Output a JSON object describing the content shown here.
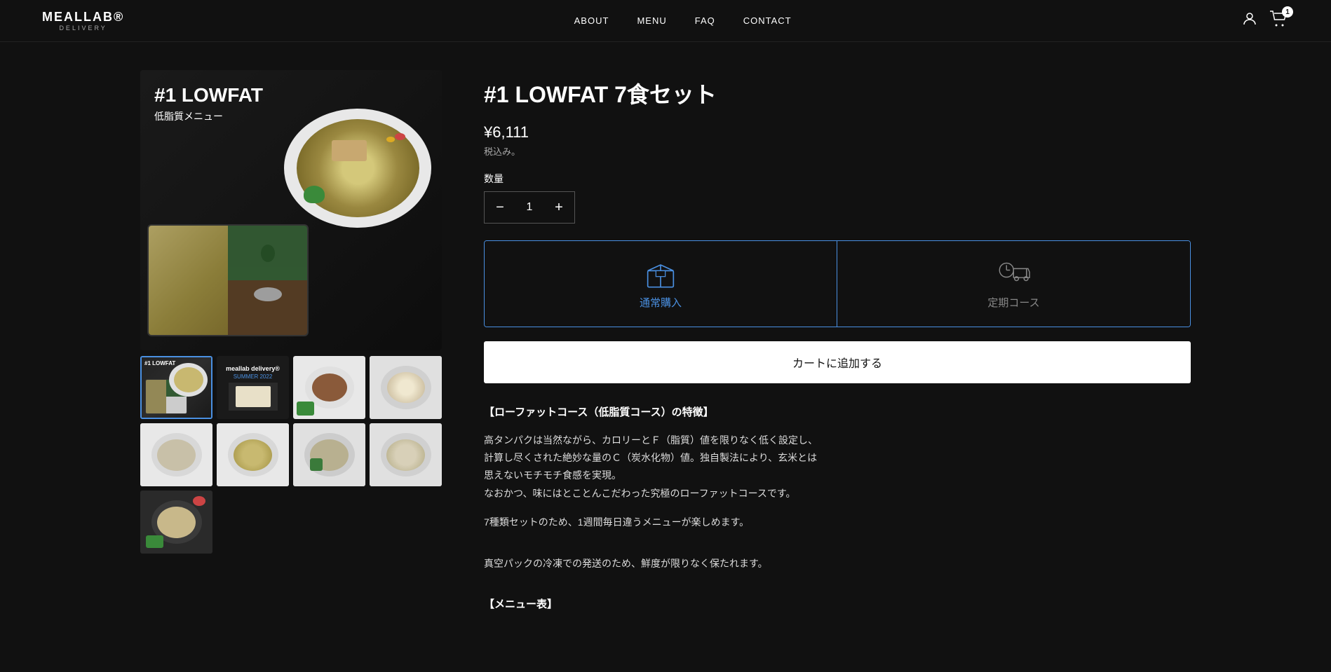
{
  "header": {
    "logo_main": "MEALLAB®",
    "logo_sub": "DELIVERY",
    "nav": {
      "about": "ABOUT",
      "menu": "MENU",
      "faq": "FAQ",
      "contact": "CONTACT"
    },
    "cart_count": "1"
  },
  "product": {
    "image_title": "#1 LOWFAT",
    "image_subtitle": "低脂質メニュー",
    "title": "#1 LOWFAT 7食セット",
    "price": "¥6,111",
    "price_note": "税込み。",
    "quantity_label": "数量",
    "quantity": "1",
    "option_normal_label": "通常購入",
    "option_subscription_label": "定期コース",
    "add_to_cart": "カートに追加する",
    "desc_heading1": "【ローファットコース（低脂質コース）の特徴】",
    "desc_body1": "高タンパクは当然ながら、カロリーとＦ（脂質）値を限りなく低く設定し、計算し尽くされた絶妙な量のＣ（炭水化物）値。独自製法により、玄米とは思えないモチモチ食感を実現。\nなおかつ、味にはとことんこだわった究極のローファットコースです。",
    "desc_body2": "7種類セットのため、1週間毎日違うメニューが楽しめます。",
    "desc_body3": "真空パックの冷凍での発送のため、鮮度が限りなく保たれます。",
    "desc_heading2": "【メニュー表】"
  }
}
